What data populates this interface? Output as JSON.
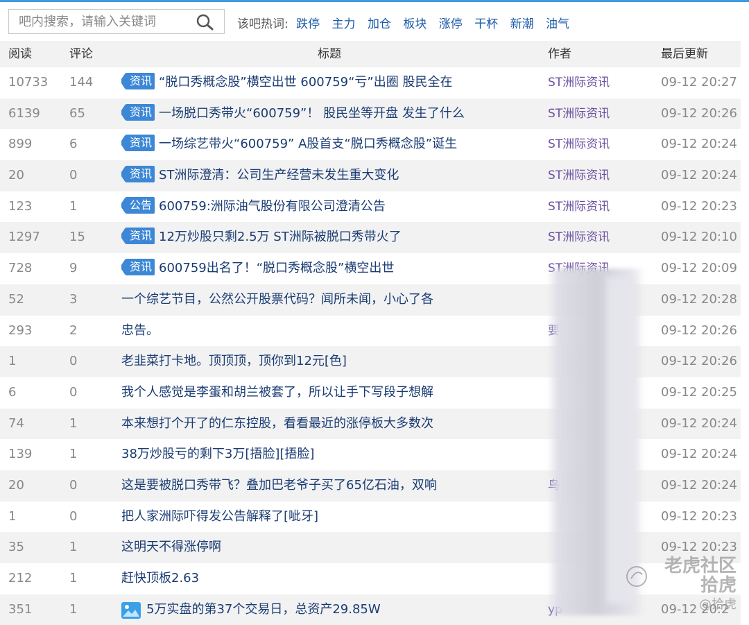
{
  "search": {
    "placeholder": "吧内搜索，请输入关键词",
    "hot_label": "该吧热词:",
    "hot_words": [
      "跌停",
      "主力",
      "加仓",
      "板块",
      "涨停",
      "干杯",
      "新潮",
      "油气"
    ]
  },
  "table": {
    "headers": {
      "read": "阅读",
      "comments": "评论",
      "title": "标题",
      "author": "作者",
      "updated": "最后更新"
    },
    "rows": [
      {
        "read": "10733",
        "comments": "144",
        "tag": "资讯",
        "title": "“脱口秀概念股”横空出世 600759“亏”出圈 股民全在",
        "author": "ST洲际资讯",
        "updated": "09-12 20:27"
      },
      {
        "read": "6139",
        "comments": "65",
        "tag": "资讯",
        "title": "一场脱口秀带火“600759”！ 股民坐等开盘 发生了什么",
        "author": "ST洲际资讯",
        "updated": "09-12 20:26"
      },
      {
        "read": "899",
        "comments": "6",
        "tag": "资讯",
        "title": "一场综艺带火“600759” A股首支“脱口秀概念股”诞生",
        "author": "ST洲际资讯",
        "updated": "09-12 20:24"
      },
      {
        "read": "20",
        "comments": "0",
        "tag": "资讯",
        "title": "ST洲际澄清：公司生产经营未发生重大变化",
        "author": "ST洲际资讯",
        "updated": "09-12 20:24"
      },
      {
        "read": "123",
        "comments": "1",
        "tag": "公告",
        "title": "600759:洲际油气股份有限公司澄清公告",
        "author": "ST洲际资讯",
        "updated": "09-12 20:23"
      },
      {
        "read": "1297",
        "comments": "15",
        "tag": "资讯",
        "title": "12万炒股只剩2.5万 ST洲际被脱口秀带火了",
        "author": "ST洲际资讯",
        "updated": "09-12 20:10"
      },
      {
        "read": "728",
        "comments": "9",
        "tag": "资讯",
        "title": "600759出名了！“脱口秀概念股”横空出世",
        "author": "ST洲际资讯",
        "updated": "09-12 20:09"
      },
      {
        "read": "52",
        "comments": "3",
        "tag": "",
        "title": "一个综艺节目，公然公开股票代码？闻所未闻，小心了各",
        "author": "",
        "updated": "09-12 20:28"
      },
      {
        "read": "293",
        "comments": "2",
        "tag": "",
        "title": "忠告。",
        "author": "要",
        "updated": "09-12 20:26"
      },
      {
        "read": "1",
        "comments": "0",
        "tag": "",
        "title": "老韭菜打卡地。顶顶顶，顶你到12元[色]",
        "author": "",
        "updated": "09-12 20:26"
      },
      {
        "read": "6",
        "comments": "0",
        "tag": "",
        "title": "我个人感觉是李蛋和胡兰被套了，所以让手下写段子想解",
        "author": "",
        "updated": "09-12 20:25"
      },
      {
        "read": "74",
        "comments": "1",
        "tag": "",
        "title": "本来想打个开了的仁东控股，看看最近的涨停板大多数次",
        "author": "",
        "updated": "09-12 20:24"
      },
      {
        "read": "139",
        "comments": "1",
        "tag": "",
        "title": "38万炒股亏的剩下3万[捂脸][捂脸]",
        "author": "",
        "updated": "09-12 20:24"
      },
      {
        "read": "20",
        "comments": "0",
        "tag": "",
        "title": "这是要被脱口秀带飞？叠加巴老爷子买了65亿石油，双响",
        "author": "鸟",
        "updated": "09-12 20:24"
      },
      {
        "read": "1",
        "comments": "0",
        "tag": "",
        "title": "把人家洲际吓得发公告解释了[呲牙]",
        "author": "",
        "updated": "09-12 20:23"
      },
      {
        "read": "35",
        "comments": "1",
        "tag": "",
        "title": "这明天不得涨停啊",
        "author": "",
        "updated": "09-12 20:23"
      },
      {
        "read": "212",
        "comments": "1",
        "tag": "",
        "title": "赶快顶板2.63",
        "author": "",
        "updated": ""
      },
      {
        "read": "351",
        "comments": "1",
        "tag": "image",
        "title": "5万实盘的第37个交易日，总资产29.85W",
        "author": "yp",
        "updated": "09-12 20:2"
      }
    ]
  },
  "watermark": {
    "line1": "老虎社区",
    "line2": "拾虎",
    "line3": "@拾虎"
  },
  "colors": {
    "accent": "#3e9be0",
    "tag_bg": "#3c87d6",
    "title": "#1a3c73",
    "author": "#6b4fa0",
    "row_alt": "#f2f2f2"
  }
}
